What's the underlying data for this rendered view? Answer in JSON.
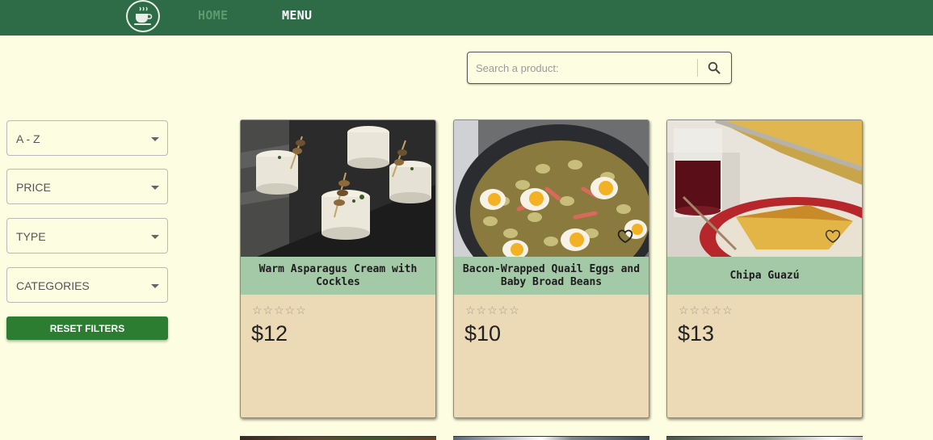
{
  "nav": {
    "home_label": "HOME",
    "menu_label": "MENU"
  },
  "search": {
    "placeholder": "Search a product:"
  },
  "filters": {
    "sort": "A - Z",
    "price": "PRICE",
    "type": "TYPE",
    "categories": "CATEGORIES",
    "reset_label": "RESET FILTERS"
  },
  "products": [
    {
      "title": "Warm Asparagus Cream with Cockles",
      "price": "$12",
      "rating": 0,
      "stars": "☆☆☆☆☆"
    },
    {
      "title": "Bacon-Wrapped Quail Eggs and Baby Broad Beans",
      "price": "$10",
      "rating": 0,
      "stars": "☆☆☆☆☆"
    },
    {
      "title": "Chipa Guazú",
      "price": "$13",
      "rating": 0,
      "stars": "☆☆☆☆☆"
    }
  ],
  "colors": {
    "navbar": "#2e6b47",
    "background": "#fdfde1",
    "card": "#ecdab6",
    "card_title": "#a3c9a6",
    "reset_button": "#2c7d32"
  }
}
